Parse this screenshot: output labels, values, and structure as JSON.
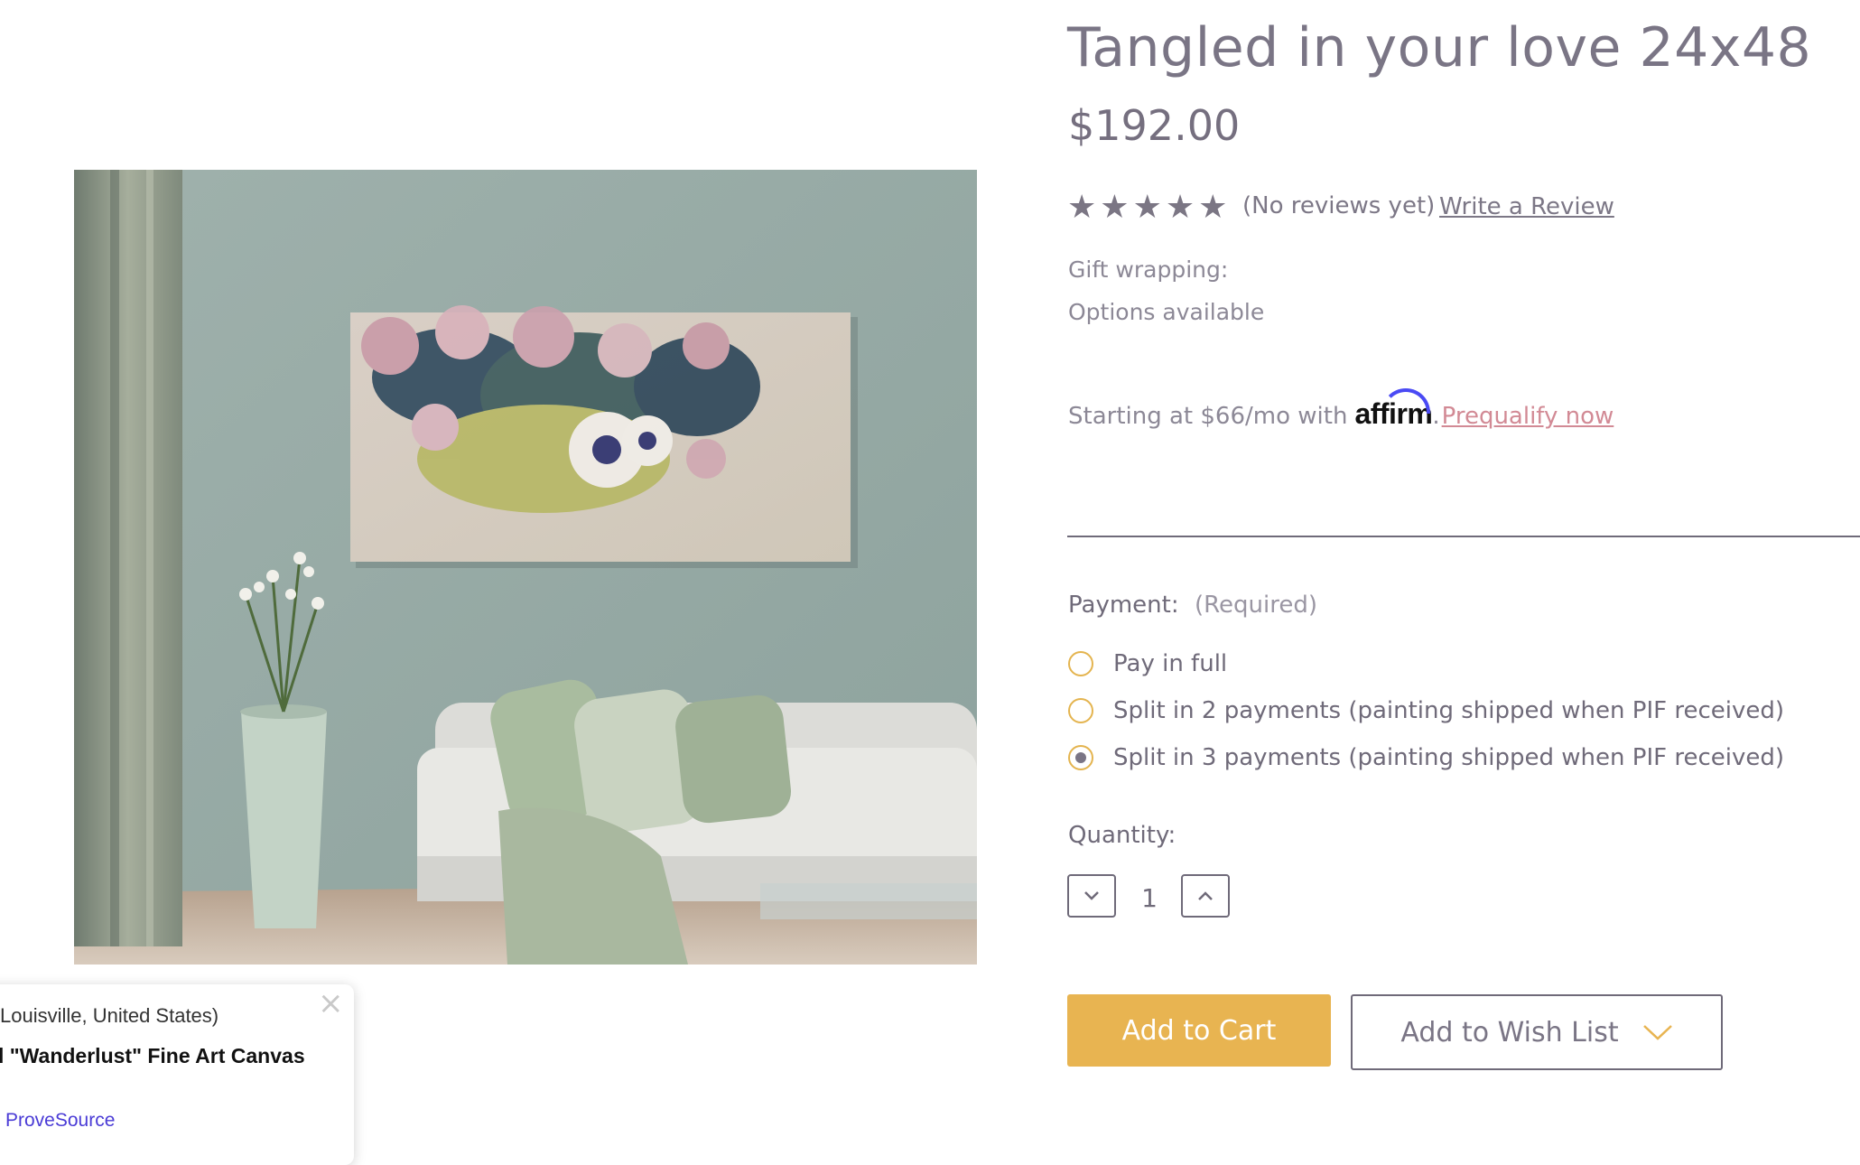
{
  "product": {
    "title": "Tangled in your love 24x48",
    "price": "$192.00",
    "rating": {
      "stars_total": 5,
      "star_glyph": "★",
      "no_reviews_text": "(No reviews yet)",
      "write_review_label": "Write a Review"
    },
    "gift_wrapping": {
      "label": "Gift wrapping:",
      "value": "Options available"
    },
    "affirm": {
      "text": "Starting at $66/mo with",
      "logo_text": "affirm",
      "separator": ".",
      "link_label": "Prequalify now"
    },
    "payment": {
      "label": "Payment:",
      "required_text": "(Required)",
      "options": [
        {
          "label": "Pay in full",
          "selected": false
        },
        {
          "label": "Split in 2 payments (painting shipped when PIF received)",
          "selected": false
        },
        {
          "label": "Split in 3 payments (painting shipped when PIF received)",
          "selected": true
        }
      ]
    },
    "quantity": {
      "label": "Quantity:",
      "value": "1"
    },
    "add_to_cart_label": "Add to Cart",
    "add_to_wishlist_label": "Add to Wish List"
  },
  "popup": {
    "location_text": "Louisville, United States)",
    "product_text": "l \"Wanderlust\" Fine Art Canvas",
    "brand_text": "ProveSource",
    "close_glyph": "×"
  },
  "colors": {
    "accent": "#e8b451",
    "text": "#6f6a79",
    "link_pink": "#d28a95",
    "affirm_blue": "#4a4af4",
    "provesource_purple": "#4a3bd6"
  },
  "icons": [
    "star-icon",
    "chevron-down-icon",
    "chevron-up-icon",
    "close-icon",
    "check-icon"
  ]
}
